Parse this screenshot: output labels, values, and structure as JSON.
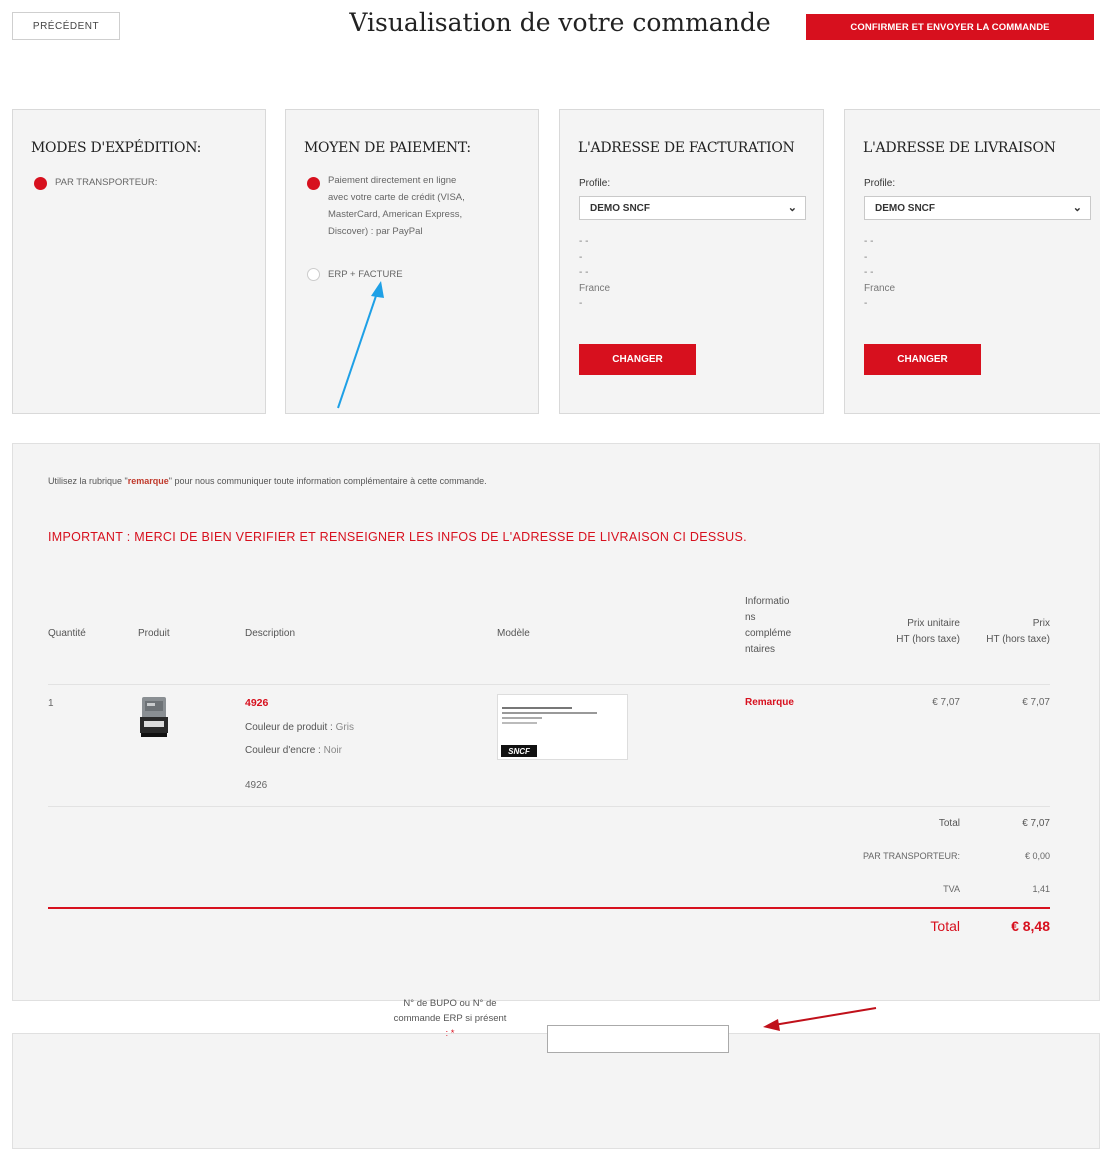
{
  "header": {
    "prev_label": "PRÉCÉDENT",
    "title": "Visualisation de votre commande",
    "confirm_label": "CONFIRMER ET ENVOYER LA COMMANDE"
  },
  "shipping": {
    "title": "MODES D'EXPÉDITION:",
    "option": "PAR TRANSPORTEUR:"
  },
  "payment": {
    "title": "MOYEN DE PAIEMENT:",
    "option1_lines": [
      "Paiement directement en ligne",
      "avec votre carte de crédit (VISA,",
      "MasterCard, American Express,",
      "Discover) : par PayPal"
    ],
    "option2": "ERP + FACTURE"
  },
  "billing": {
    "title": "L'ADRESSE DE FACTURATION",
    "profile_label": "Profile:",
    "profile_value": "DEMO SNCF",
    "addr_lines": [
      "- -",
      "-",
      "- -",
      "France",
      "-"
    ],
    "change_label": "CHANGER"
  },
  "delivery": {
    "title": "L'ADRESSE DE LIVRAISON",
    "profile_label": "Profile:",
    "profile_value": "DEMO SNCF",
    "addr_lines": [
      "- -",
      "-",
      "- -",
      "France",
      "-"
    ],
    "change_label": "CHANGER"
  },
  "order": {
    "info_pre": "Utilisez la rubrique \"",
    "info_hl": "remarque",
    "info_post": "\" pour nous communiquer toute information complémentaire à cette commande.",
    "important": "IMPORTANT : MERCI DE BIEN VERIFIER ET RENSEIGNER LES INFOS DE L'ADRESSE DE LIVRAISON CI DESSUS.",
    "headers": {
      "quantity": "Quantité",
      "product": "Produit",
      "description": "Description",
      "model": "Modèle",
      "info_lines": [
        "Informatio",
        "ns",
        "compléme",
        "ntaires"
      ],
      "unit_price_lines": [
        "Prix unitaire",
        "HT (hors taxe)"
      ],
      "price_lines": [
        "Prix",
        "HT (hors taxe)"
      ]
    },
    "row": {
      "quantity": "1",
      "name": "4926",
      "color_label": "Couleur de produit :",
      "color_value": "Gris",
      "ink_label": "Couleur d'encre :",
      "ink_value": "Noir",
      "ref": "4926",
      "model_logo": "SNCF",
      "remark": "Remarque",
      "unit_price": "€ 7,07",
      "price": "€ 7,07"
    },
    "totals": {
      "total_label": "Total",
      "total_value": "€ 7,07",
      "shipping_label": "PAR TRANSPORTEUR:",
      "shipping_value": "€ 0,00",
      "tva_label": "TVA",
      "tva_value": "1,41",
      "grand_label": "Total",
      "grand_value": "€ 8,48"
    }
  },
  "erp": {
    "label_lines": [
      "N° de BUPO ou N° de",
      "commande ERP si présent"
    ],
    "required_mark": ": *",
    "input_value": ""
  },
  "colors": {
    "accent": "#d7101e",
    "annotation_blue": "#1ea0e6",
    "annotation_red": "#c0101a"
  }
}
